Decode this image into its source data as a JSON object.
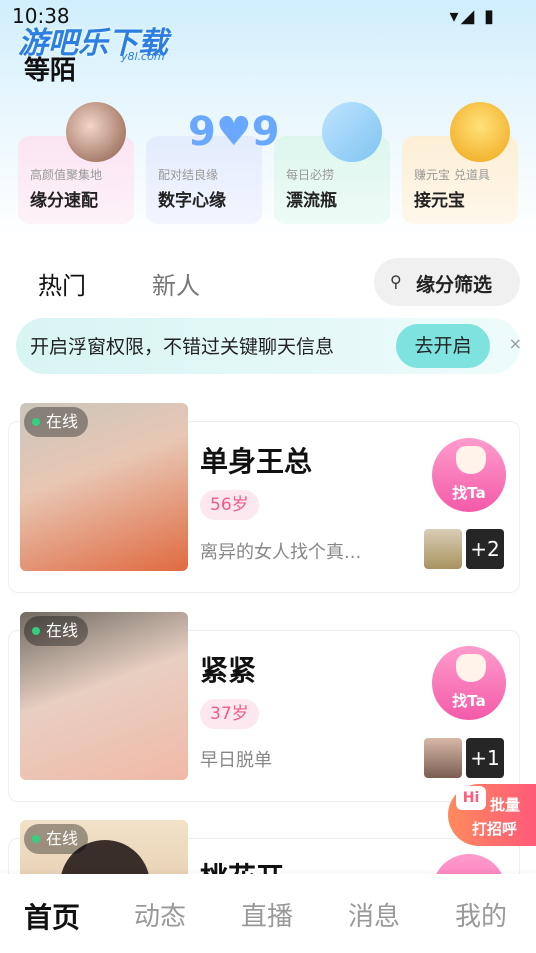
{
  "status": {
    "time": "10:38",
    "icons": "▾◢ ▮"
  },
  "watermark": {
    "main": "游吧乐下载",
    "sub": "y8l.com"
  },
  "app": {
    "title": "等陌"
  },
  "feature_cards": [
    {
      "sub": "高颜值聚集地",
      "title": "缘分速配",
      "icon": "avatar-icon"
    },
    {
      "sub": "配对结良缘",
      "title": "数字心缘",
      "icon": "heart-99-icon"
    },
    {
      "sub": "每日必捞",
      "title": "漂流瓶",
      "icon": "bottle-icon"
    },
    {
      "sub": "赚元宝 兑道具",
      "title": "接元宝",
      "icon": "gold-ingot-icon"
    }
  ],
  "tabs": [
    {
      "label": "热门",
      "active": true
    },
    {
      "label": "新人",
      "active": false
    }
  ],
  "filter": {
    "icon": "filter-icon",
    "label": "缘分筛选"
  },
  "banner": {
    "text": "开启浮窗权限，不错过关键聊天信息",
    "button": "去开启",
    "close": "×"
  },
  "users": [
    {
      "online": "在线",
      "name": "单身王总",
      "age": "56岁",
      "bio": "离异的女人找个真...",
      "more": "+2",
      "action": "找Ta"
    },
    {
      "online": "在线",
      "name": "紧紧",
      "age": "37岁",
      "bio": "早日脱单",
      "more": "+1",
      "action": "找Ta"
    },
    {
      "online": "在线",
      "name": "桃花开",
      "age": "",
      "bio": "",
      "more": "",
      "action": ""
    }
  ],
  "float_button": {
    "hi": "Hi",
    "line1": "批量",
    "line2": "打招呼"
  },
  "nav": [
    {
      "label": "首页",
      "active": true
    },
    {
      "label": "动态",
      "active": false
    },
    {
      "label": "直播",
      "active": false
    },
    {
      "label": "消息",
      "active": false
    },
    {
      "label": "我的",
      "active": false
    }
  ],
  "colors": {
    "accent_pink": "#f35aa8",
    "banner_btn": "#7ee3df",
    "online_dot": "#35d07f"
  }
}
